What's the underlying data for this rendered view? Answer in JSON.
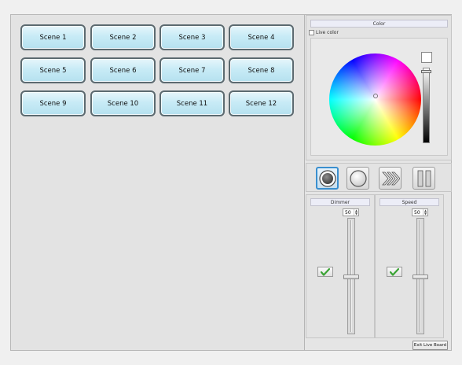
{
  "scenes": {
    "items": [
      {
        "label": "Scene 1"
      },
      {
        "label": "Scene 2"
      },
      {
        "label": "Scene 3"
      },
      {
        "label": "Scene 4"
      },
      {
        "label": "Scene 5"
      },
      {
        "label": "Scene 6"
      },
      {
        "label": "Scene 7"
      },
      {
        "label": "Scene 8"
      },
      {
        "label": "Scene 9"
      },
      {
        "label": "Scene 10"
      },
      {
        "label": "Scene 11"
      },
      {
        "label": "Scene 12"
      }
    ]
  },
  "color": {
    "title": "Color",
    "live_color_label": "Live color",
    "live_color_checked": false,
    "selected_brightness": "#ffffff"
  },
  "transport": {
    "buttons": [
      {
        "icon": "record-circle-icon",
        "active": true
      },
      {
        "icon": "stop-circle-icon",
        "active": false
      },
      {
        "icon": "fast-forward-chevrons-icon",
        "active": false
      },
      {
        "icon": "pause-icon",
        "active": false
      }
    ]
  },
  "dimmer": {
    "title": "Dimmer",
    "value": "50",
    "level_percent": 50,
    "enabled": true
  },
  "speed": {
    "title": "Speed",
    "value": "50",
    "level_percent": 50,
    "enabled": true
  },
  "footer": {
    "exit_label": "Exit Live Board"
  },
  "colors": {
    "scene_button_top": "#e6f6fb",
    "scene_button_bottom": "#b5e1ef",
    "active_accent": "#3a8fcf",
    "check_green": "#3aa334"
  }
}
